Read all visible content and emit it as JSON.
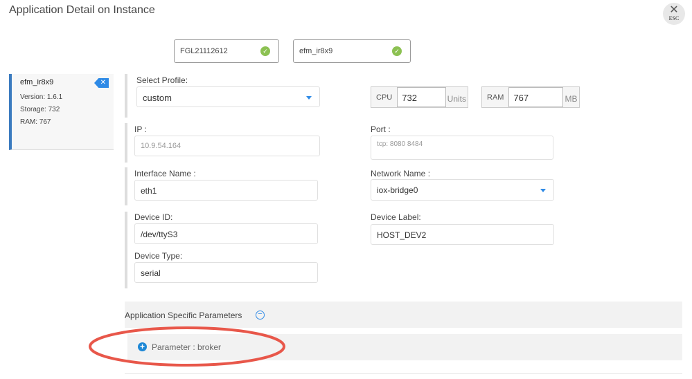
{
  "header": {
    "title": "Application Detail on Instance",
    "esc_label": "ESC"
  },
  "devices": [
    {
      "name": "FGL21112612",
      "status": "ok"
    },
    {
      "name": "efm_ir8x9",
      "status": "ok"
    }
  ],
  "app_card": {
    "name": "efm_ir8x9",
    "version": "Version: 1.6.1",
    "storage": "Storage: 732",
    "ram": "RAM: 767"
  },
  "form": {
    "profile_label": "Select Profile:",
    "profile_value": "custom",
    "cpu_label": "CPU",
    "cpu_value": "732",
    "cpu_unit": "Units",
    "ram_label": "RAM",
    "ram_value": "767",
    "ram_unit": "MB",
    "ip_label": "IP :",
    "ip_value": "10.9.54.164",
    "port_label": "Port :",
    "port_value": "tcp: 8080 8484",
    "interface_label": "Interface Name :",
    "interface_value": "eth1",
    "network_label": "Network Name :",
    "network_value": "iox-bridge0",
    "device_id_label": "Device ID:",
    "device_id_value": "/dev/ttyS3",
    "device_label_label": "Device Label:",
    "device_label_value": "HOST_DEV2",
    "device_type_label": "Device Type:",
    "device_type_value": "serial"
  },
  "params": {
    "section_title": "Application Specific Parameters",
    "items": [
      {
        "label": "Parameter : broker"
      }
    ]
  },
  "colors": {
    "accent": "#2e8ae6",
    "ok": "#8cc152",
    "highlight": "#e8574a"
  }
}
